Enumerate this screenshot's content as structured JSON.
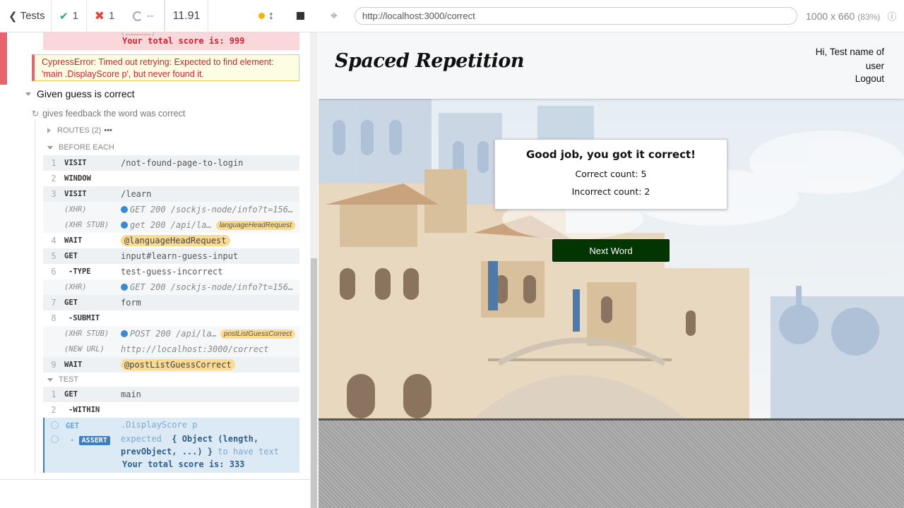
{
  "reporter": {
    "back_label": "Tests",
    "passed": "1",
    "failed": "1",
    "pending": "--",
    "duration": "11.91",
    "prev_error_partial": "Your total score is: 999",
    "cypress_error": "CypressError: Timed out retrying: Expected to find element: 'main .DisplayScore p', but never found it.",
    "suite_title": "Given guess is correct",
    "test_title": "gives feedback the word was correct",
    "routes_label": "ROUTES (2)",
    "before_each_label": "BEFORE EACH",
    "test_label": "TEST",
    "before_each_commands": [
      {
        "num": "1",
        "name": "VISIT",
        "msg": "/not-found-page-to-login"
      },
      {
        "num": "2",
        "name": "WINDOW",
        "msg": ""
      },
      {
        "num": "3",
        "name": "VISIT",
        "msg": "/learn"
      },
      {
        "num": "",
        "name": "(XHR)",
        "msg": "GET 200 /sockjs-node/info?t=156…",
        "xhr": true
      },
      {
        "num": "",
        "name": "(XHR STUB)",
        "msg": "get 200 /api/la…",
        "xhr": true,
        "alias": "languageHeadRequest"
      },
      {
        "num": "4",
        "name": "WAIT",
        "msg": "@languageHeadRequest",
        "pill": true
      },
      {
        "num": "5",
        "name": "GET",
        "msg": "input#learn-guess-input"
      },
      {
        "num": "6",
        "name": "-TYPE",
        "msg": "test-guess-incorrect"
      },
      {
        "num": "",
        "name": "(XHR)",
        "msg": "GET 200 /sockjs-node/info?t=156…",
        "xhr": true
      },
      {
        "num": "7",
        "name": "GET",
        "msg": "form"
      },
      {
        "num": "8",
        "name": "-SUBMIT",
        "msg": ""
      },
      {
        "num": "",
        "name": "(XHR STUB)",
        "msg": "POST 200 /api/la…",
        "xhr": true,
        "alias": "postListGuessCorrect"
      },
      {
        "num": "",
        "name": "(NEW URL)",
        "msg": "http://localhost:3000/correct"
      },
      {
        "num": "9",
        "name": "WAIT",
        "msg": "@postListGuessCorrect",
        "pill": true
      }
    ],
    "test_commands": [
      {
        "num": "1",
        "name": "GET",
        "msg": "main"
      },
      {
        "num": "2",
        "name": "-WITHIN",
        "msg": ""
      }
    ],
    "pending_get": {
      "name": "GET",
      "msg": ".DisplayScore p"
    },
    "pending_assert": {
      "name": "ASSERT",
      "expected": "expected",
      "object": "{ Object (length,",
      "object2": "prevObject, ...) }",
      "to_have_text": "to have text",
      "value": "Your total score is: 333"
    }
  },
  "browser": {
    "url": "http://localhost:3000/correct",
    "viewport": "1000 x 660",
    "zoom": "(83%)"
  },
  "app": {
    "logo": "Spaced Repetition",
    "greeting": "Hi, Test name of user",
    "logout": "Logout",
    "feedback_title": "Good job, you got it correct!",
    "correct_count": "Correct count: 5",
    "incorrect_count": "Incorrect count: 2",
    "next_button": "Next Word"
  },
  "colors": {
    "pass": "#2aa865",
    "fail": "#e1463a",
    "next_button_bg": "#033503",
    "running_blue": "#3a7fc4"
  }
}
